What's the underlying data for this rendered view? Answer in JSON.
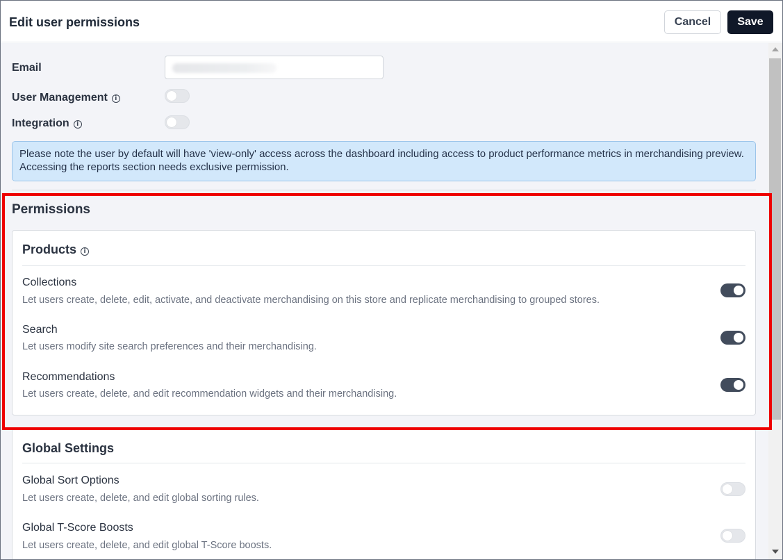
{
  "dialog": {
    "title": "Edit user permissions",
    "cancel_label": "Cancel",
    "save_label": "Save"
  },
  "form": {
    "email_label": "Email",
    "email_value": "",
    "user_management_label": "User Management",
    "user_management_enabled": false,
    "integration_label": "Integration",
    "integration_enabled": false,
    "info_icon": "info-icon"
  },
  "note": {
    "text": "Please note the user by default will have 'view-only' access across the dashboard including access to product performance metrics in merchandising preview. Accessing the reports section needs exclusive permission."
  },
  "permissions": {
    "title": "Permissions",
    "products": {
      "title": "Products",
      "items": [
        {
          "name": "Collections",
          "description": "Let users create, delete, edit, activate, and deactivate merchandising on this store and replicate merchandising to grouped stores.",
          "enabled": true
        },
        {
          "name": "Search",
          "description": "Let users modify site search preferences and their merchandising.",
          "enabled": true
        },
        {
          "name": "Recommendations",
          "description": "Let users create, delete, and edit recommendation widgets and their merchandising.",
          "enabled": true
        }
      ]
    },
    "global_settings": {
      "title": "Global Settings",
      "items": [
        {
          "name": "Global Sort Options",
          "description": "Let users create, delete, and edit global sorting rules.",
          "enabled": false
        },
        {
          "name": "Global T-Score Boosts",
          "description": "Let users create, delete, and edit global T-Score boosts.",
          "enabled": false
        }
      ]
    }
  },
  "colors": {
    "highlight": "#ee0000",
    "toggle_on": "#424c5c",
    "note_background": "#d2e8fb",
    "save_button": "#101828"
  }
}
